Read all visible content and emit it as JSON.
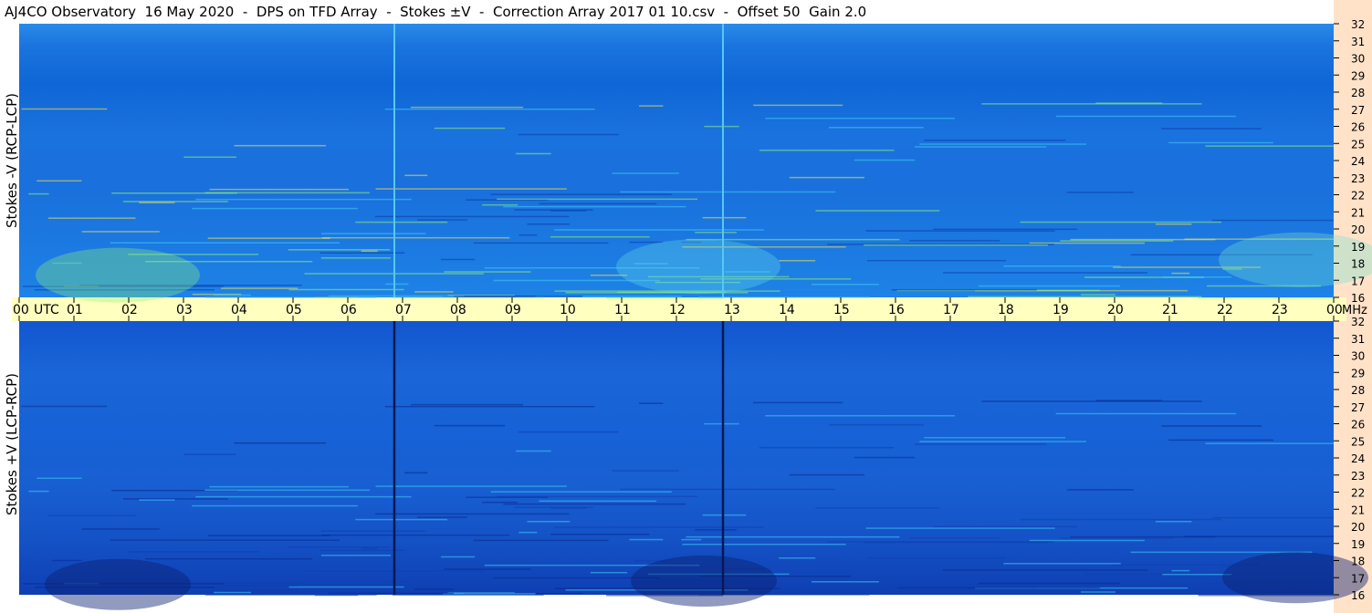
{
  "window": {
    "title": "AJ4CO Observatory  16 May 2020  -  DPS on TFD Array  -  Stokes ±V  -  Correction Array 2017 01 10.csv  -  Offset 50  Gain 2.0"
  },
  "colors": {
    "plot_background_top": "#1a72de",
    "plot_background_bottom": "#1660d4",
    "time_axis_band": "#ffffc0",
    "frequency_axis_band": "#ffe2c8",
    "marker_line_top": "#56c8f0",
    "marker_line_bottom": "#0a1850",
    "burst_green": "#8cf07a",
    "burst_yellow": "#f0e050"
  },
  "chart_data": [
    {
      "type": "heatmap",
      "title": "",
      "ylabel": "Stokes -V (RCP-LCP)",
      "xlabel": "",
      "x_unit": "UTC",
      "y_unit": "MHz",
      "xlim": [
        0,
        24
      ],
      "ylim": [
        16,
        32
      ],
      "x_ticks": [
        "00",
        "01",
        "02",
        "03",
        "04",
        "05",
        "06",
        "07",
        "08",
        "09",
        "10",
        "11",
        "12",
        "13",
        "14",
        "15",
        "16",
        "17",
        "18",
        "19",
        "20",
        "21",
        "22",
        "23",
        "00"
      ],
      "y_ticks": [
        "16",
        "17",
        "18",
        "19",
        "20",
        "21",
        "22",
        "23",
        "24",
        "25",
        "26",
        "27",
        "28",
        "29",
        "30",
        "31",
        "32"
      ],
      "vertical_markers_utc": [
        6.85,
        12.85
      ],
      "grid": false
    },
    {
      "type": "heatmap",
      "title": "",
      "ylabel": "Stokes +V (LCP-RCP)",
      "xlabel": "",
      "x_unit": "UTC",
      "y_unit": "MHz",
      "xlim": [
        0,
        24
      ],
      "ylim": [
        16,
        32
      ],
      "x_ticks": [
        "00",
        "01",
        "02",
        "03",
        "04",
        "05",
        "06",
        "07",
        "08",
        "09",
        "10",
        "11",
        "12",
        "13",
        "14",
        "15",
        "16",
        "17",
        "18",
        "19",
        "20",
        "21",
        "22",
        "23",
        "00"
      ],
      "y_ticks": [
        "16",
        "17",
        "18",
        "19",
        "20",
        "21",
        "22",
        "23",
        "24",
        "25",
        "26",
        "27",
        "28",
        "29",
        "30",
        "31",
        "32"
      ],
      "vertical_markers_utc": [
        6.85,
        12.85
      ],
      "grid": false
    }
  ],
  "axis": {
    "time_label": "UTC",
    "freq_label": "MHz"
  }
}
